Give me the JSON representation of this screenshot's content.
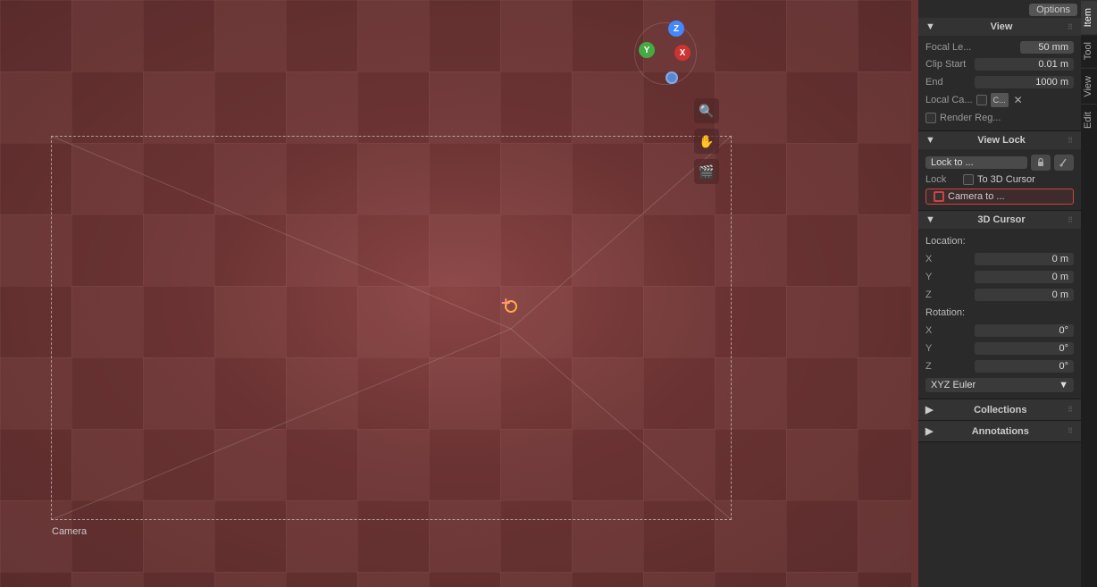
{
  "viewport": {
    "camera_label": "Camera"
  },
  "nav_gizmo": {
    "z_label": "Z",
    "y_label": "Y",
    "x_label": "X"
  },
  "tools": [
    {
      "icon": "🔍",
      "name": "zoom-tool"
    },
    {
      "icon": "✋",
      "name": "pan-tool"
    },
    {
      "icon": "🎬",
      "name": "camera-tool"
    }
  ],
  "vertical_tabs": [
    {
      "label": "Item",
      "active": true
    },
    {
      "label": "Tool",
      "active": false
    },
    {
      "label": "View",
      "active": false
    },
    {
      "label": "Edit",
      "active": false
    }
  ],
  "panel": {
    "options_button": "Options",
    "view_section": {
      "title": "View",
      "focal_length_label": "Focal Le...",
      "focal_length_value": "50 mm",
      "clip_start_label": "Clip Start",
      "clip_start_value": "0.01 m",
      "clip_end_label": "End",
      "clip_end_value": "1000 m",
      "local_camera_label": "Local Ca...",
      "local_camera_icon": "C...",
      "render_regions_label": "Render Reg..."
    },
    "view_lock_section": {
      "title": "View Lock",
      "lock_to_label": "Lock to ...",
      "lock_label": "Lock",
      "to_3d_cursor_label": "To 3D Cursor",
      "camera_to_label": "Camera to ..."
    },
    "cursor_3d_section": {
      "title": "3D Cursor",
      "location_label": "Location:",
      "x_label": "X",
      "x_value": "0 m",
      "y_label": "Y",
      "y_value": "0 m",
      "z_label": "Z",
      "z_value": "0 m",
      "rotation_label": "Rotation:",
      "rx_label": "X",
      "rx_value": "0°",
      "ry_label": "Y",
      "ry_value": "0°",
      "rz_label": "Z",
      "rz_value": "0°",
      "mode_label": "XYZ Euler",
      "mode_arrow": "▼"
    },
    "collections_section": {
      "title": "Collections",
      "collapsed": true
    },
    "annotations_section": {
      "title": "Annotations",
      "collapsed": true
    }
  }
}
